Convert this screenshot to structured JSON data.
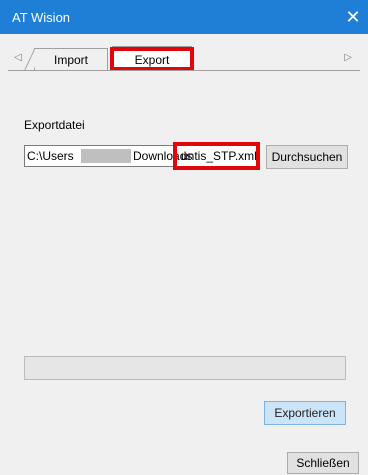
{
  "window": {
    "title": "AT Wision",
    "close_glyph": "✕",
    "close_icon": "close-icon"
  },
  "tabs": {
    "left_glyph": "◁",
    "right_glyph": "▷",
    "items": [
      {
        "label": "Import"
      },
      {
        "label": "Export"
      }
    ],
    "selected": "Export"
  },
  "export_panel": {
    "file_label": "Exportdatei",
    "path": {
      "prefix": "C:\\Users",
      "middle": "Downloads",
      "filename": "untis_STP.xml"
    },
    "browse_label": "Durchsuchen",
    "progress": 0,
    "export_label": "Exportieren"
  },
  "footer": {
    "close_label": "Schließen"
  },
  "colors": {
    "titlebar": "#1f7fd6",
    "highlight": "#e0070a",
    "export_button": "#cce4f7"
  }
}
